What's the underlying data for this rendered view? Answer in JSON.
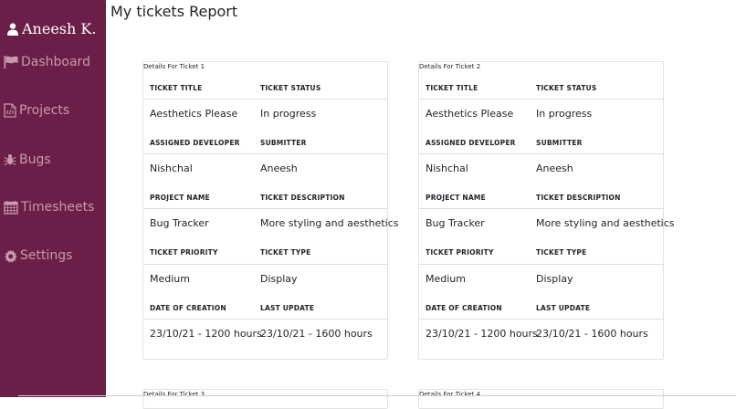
{
  "sidebar": {
    "user_name": "Aneesh K.",
    "user_icon": "user-icon",
    "items": [
      {
        "label": "Dashboard",
        "icon": "flag-icon"
      },
      {
        "label": "Projects",
        "icon": "code-file-icon"
      },
      {
        "label": "Bugs",
        "icon": "bug-icon"
      },
      {
        "label": "Timesheets",
        "icon": "calendar-icon"
      },
      {
        "label": "Settings",
        "icon": "gear-icon"
      }
    ],
    "bg_color": "#6b1f48",
    "text_color": "#c79aae"
  },
  "page": {
    "title": "My tickets Report"
  },
  "labels": {
    "ticket_title": "TICKET TITLE",
    "ticket_status": "TICKET STATUS",
    "assigned_developer": "ASSIGNED DEVELOPER",
    "submitter": "SUBMITTER",
    "project_name": "PROJECT NAME",
    "ticket_description": "TICKET DESCRIPTION",
    "ticket_priority": "TICKET PRIORITY",
    "ticket_type": "TICKET TYPE",
    "date_of_creation": "DATE OF CREATION",
    "last_update": "LAST UPDATE"
  },
  "tickets": [
    {
      "heading": "Details For Ticket 1",
      "title": "Aesthetics Please",
      "status": "In progress",
      "developer": "Nishchal",
      "submitter": "Aneesh",
      "project": "Bug Tracker",
      "description": "More styling and aesthetics",
      "priority": "Medium",
      "type": "Display",
      "created": "23/10/21 - 1200 hours",
      "updated": "23/10/21 - 1600 hours"
    },
    {
      "heading": "Details For Ticket 2",
      "title": "Aesthetics Please",
      "status": "In progress",
      "developer": "Nishchal",
      "submitter": "Aneesh",
      "project": "Bug Tracker",
      "description": "More styling and aesthetics",
      "priority": "Medium",
      "type": "Display",
      "created": "23/10/21 - 1200 hours",
      "updated": "23/10/21 - 1600 hours"
    },
    {
      "heading": "Details For Ticket 3"
    },
    {
      "heading": "Details For Ticket 4"
    }
  ]
}
